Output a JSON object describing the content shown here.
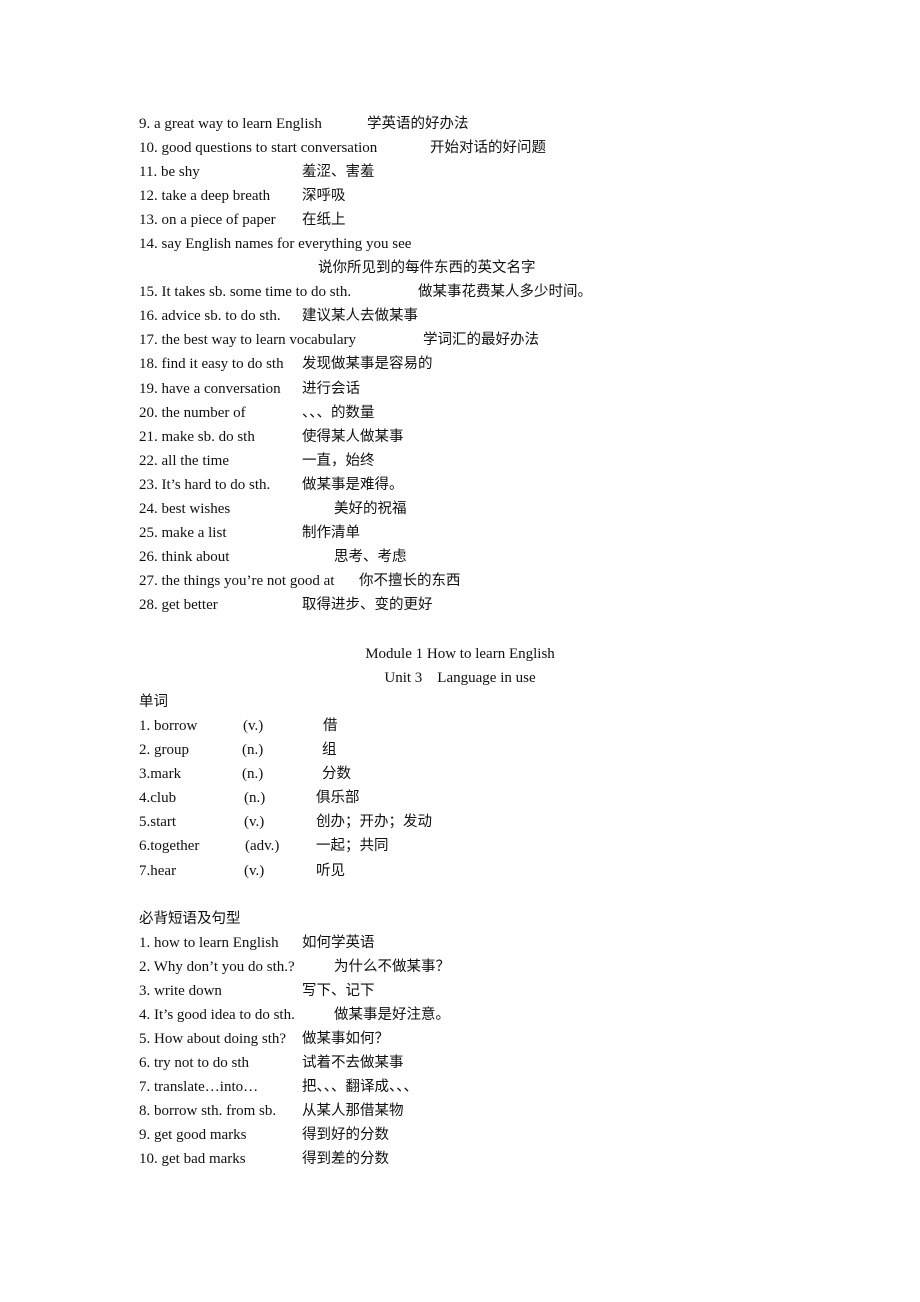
{
  "phrases_part1": [
    {
      "en": "9. a great way to learn English",
      "zh": "学英语的好办法"
    },
    {
      "en": "10. good questions to start conversation",
      "zh": "开始对话的好问题"
    },
    {
      "en": "11. be shy",
      "zh": "羞涩、害羞"
    },
    {
      "en": "12. take a deep breath",
      "zh": "深呼吸"
    },
    {
      "en": "13. on a piece of paper",
      "zh": "在纸上"
    },
    {
      "en": "14. say English names for everything you see",
      "zh": "说你所见到的每件东西的英文名字"
    },
    {
      "en": "15. It takes sb. some time to do sth.",
      "zh": "做某事花费某人多少时间。"
    },
    {
      "en": "16. advice sb. to do sth.",
      "zh": "建议某人去做某事"
    },
    {
      "en": "17. the best way to learn vocabulary",
      "zh": "学词汇的最好办法"
    },
    {
      "en": "18. find it easy to do sth",
      "zh": "发现做某事是容易的"
    },
    {
      "en": "19. have a conversation",
      "zh": "进行会话"
    },
    {
      "en": "20. the number of",
      "zh": "、、、的数量"
    },
    {
      "en": "21. make sb. do sth",
      "zh": "使得某人做某事"
    },
    {
      "en": "22. all the time",
      "zh": "一直，始终"
    },
    {
      "en": "23. It’s hard to do sth.",
      "zh": "做某事是难得。"
    },
    {
      "en": "24. best wishes",
      "zh": "美好的祝福"
    },
    {
      "en": "25. make a list",
      "zh": "制作清单"
    },
    {
      "en": "26. think about",
      "zh": "思考、考虑"
    },
    {
      "en": "27. the things you’re not good at",
      "zh": "你不擅长的东西"
    },
    {
      "en": "28. get better",
      "zh": "取得进步、变的更好"
    }
  ],
  "section": {
    "module_title": "Module 1 How to learn English",
    "unit_title": "Unit 3    Language in use",
    "vocab_heading": "单词",
    "phrases_heading": "必背短语及句型"
  },
  "vocabulary": [
    {
      "word": "1. borrow",
      "pos": "(v.)",
      "zh": "借"
    },
    {
      "word": "2. group",
      "pos": "(n.)",
      "zh": "组"
    },
    {
      "word": "3.mark",
      "pos": "(n.)",
      "zh": "分数"
    },
    {
      "word": "4.club",
      "pos": "(n.)",
      "zh": "俱乐部"
    },
    {
      "word": "5.start",
      "pos": "(v.)",
      "zh": "创办；开办；发动"
    },
    {
      "word": "6.together",
      "pos": "(adv.)",
      "zh": "一起；共同"
    },
    {
      "word": "7.hear",
      "pos": "(v.)",
      "zh": "听见"
    }
  ],
  "phrases_part2": [
    {
      "en": "1. how to learn English",
      "zh": "如何学英语"
    },
    {
      "en": "2. Why don’t you do sth.?",
      "zh": "为什么不做某事？"
    },
    {
      "en": "3. write down",
      "zh": "写下、记下"
    },
    {
      "en": "4. It’s good idea to do sth.",
      "zh": "做某事是好注意。"
    },
    {
      "en": "5. How about doing sth?",
      "zh": "做某事如何？"
    },
    {
      "en": "6. try not to do sth",
      "zh": "试着不去做某事"
    },
    {
      "en": "7. translate…into…",
      "zh": "把、、、翻译成、、、"
    },
    {
      "en": "8. borrow sth. from sb.",
      "zh": "从某人那借某物"
    },
    {
      "en": "9. get good marks",
      "zh": "得到好的分数"
    },
    {
      "en": "10. get bad marks",
      "zh": "得到差的分数"
    }
  ]
}
